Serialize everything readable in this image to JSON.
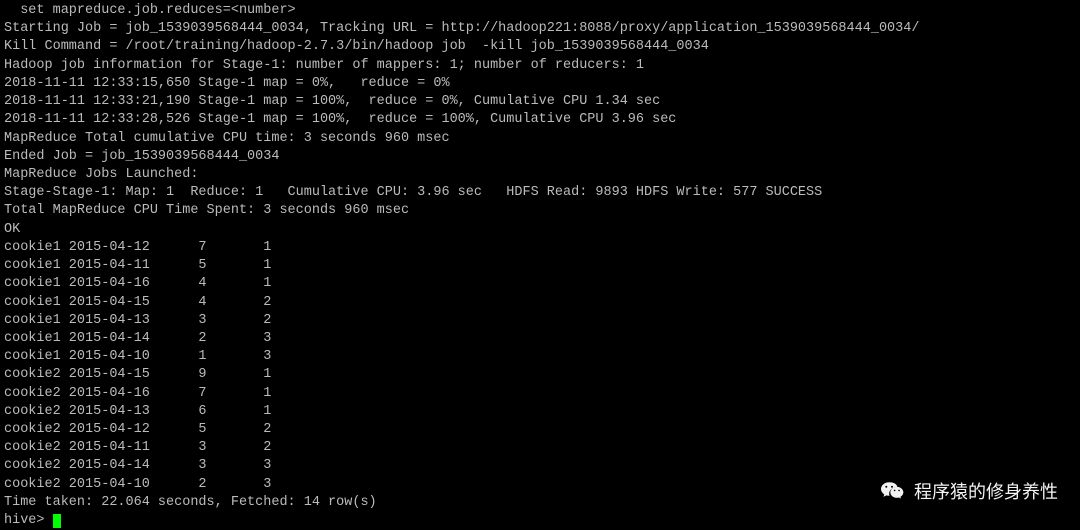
{
  "lines": {
    "l0": "  set mapreduce.job.reduces=<number>",
    "l1": "Starting Job = job_1539039568444_0034, Tracking URL = http://hadoop221:8088/proxy/application_1539039568444_0034/",
    "l2": "Kill Command = /root/training/hadoop-2.7.3/bin/hadoop job  -kill job_1539039568444_0034",
    "l3": "Hadoop job information for Stage-1: number of mappers: 1; number of reducers: 1",
    "l4": "2018-11-11 12:33:15,650 Stage-1 map = 0%,   reduce = 0%",
    "l5": "2018-11-11 12:33:21,190 Stage-1 map = 100%,  reduce = 0%, Cumulative CPU 1.34 sec",
    "l6": "2018-11-11 12:33:28,526 Stage-1 map = 100%,  reduce = 100%, Cumulative CPU 3.96 sec",
    "l7": "MapReduce Total cumulative CPU time: 3 seconds 960 msec",
    "l8": "Ended Job = job_1539039568444_0034",
    "l9": "MapReduce Jobs Launched:",
    "l10": "Stage-Stage-1: Map: 1  Reduce: 1   Cumulative CPU: 3.96 sec   HDFS Read: 9893 HDFS Write: 577 SUCCESS",
    "l11": "Total MapReduce CPU Time Spent: 3 seconds 960 msec",
    "l12": "OK"
  },
  "rows": [
    {
      "c0": "cookie1",
      "c1": "2015-04-12",
      "c2": "7",
      "c3": "1"
    },
    {
      "c0": "cookie1",
      "c1": "2015-04-11",
      "c2": "5",
      "c3": "1"
    },
    {
      "c0": "cookie1",
      "c1": "2015-04-16",
      "c2": "4",
      "c3": "1"
    },
    {
      "c0": "cookie1",
      "c1": "2015-04-15",
      "c2": "4",
      "c3": "2"
    },
    {
      "c0": "cookie1",
      "c1": "2015-04-13",
      "c2": "3",
      "c3": "2"
    },
    {
      "c0": "cookie1",
      "c1": "2015-04-14",
      "c2": "2",
      "c3": "3"
    },
    {
      "c0": "cookie1",
      "c1": "2015-04-10",
      "c2": "1",
      "c3": "3"
    },
    {
      "c0": "cookie2",
      "c1": "2015-04-15",
      "c2": "9",
      "c3": "1"
    },
    {
      "c0": "cookie2",
      "c1": "2015-04-16",
      "c2": "7",
      "c3": "1"
    },
    {
      "c0": "cookie2",
      "c1": "2015-04-13",
      "c2": "6",
      "c3": "1"
    },
    {
      "c0": "cookie2",
      "c1": "2015-04-12",
      "c2": "5",
      "c3": "2"
    },
    {
      "c0": "cookie2",
      "c1": "2015-04-11",
      "c2": "3",
      "c3": "2"
    },
    {
      "c0": "cookie2",
      "c1": "2015-04-14",
      "c2": "3",
      "c3": "3"
    },
    {
      "c0": "cookie2",
      "c1": "2015-04-10",
      "c2": "2",
      "c3": "3"
    }
  ],
  "footer": {
    "time": "Time taken: 22.064 seconds, Fetched: 14 row(s)",
    "prompt": "hive> "
  },
  "watermark": {
    "text": "程序猿的修身养性"
  }
}
